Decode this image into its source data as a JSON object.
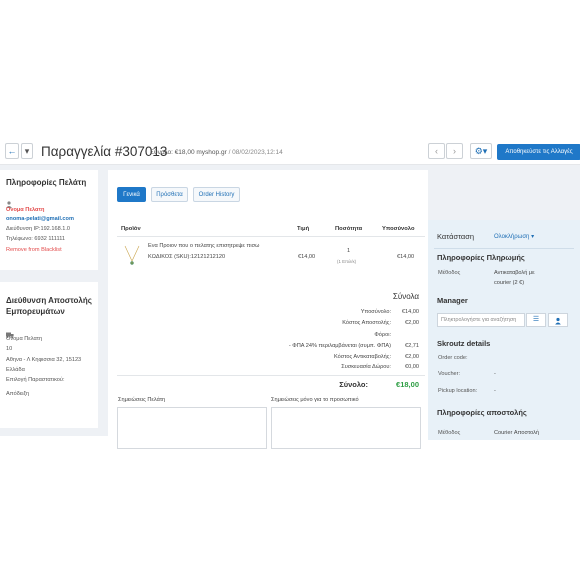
{
  "header": {
    "title": "Παραγγελία #307013",
    "total": "Σύνολο: €18,00",
    "shop": "myshop.gr",
    "date": "/ 08/02/2023,12:14",
    "save_label": "Αποθηκεύστε τις Αλλαγές",
    "back_icon": "←",
    "dropdown_icon": "▾",
    "prev_icon": "‹",
    "next_icon": "›",
    "settings_icon": "⚙▾"
  },
  "customer": {
    "title": "Πληροφορίες Πελάτη",
    "name": "Ονομα Πελατη",
    "email": "onoma-pelati@gmail.com",
    "ip": "Διεύθυνση IP:192.168.1.0",
    "phone": "Τηλέφωνο: 6932 111111",
    "blacklist": "Remove from Blacklist"
  },
  "shipping_address": {
    "title_line1": "Διεύθυνση Αποστολής",
    "title_line2": "Εμπορευμάτων",
    "name": "Ονομα Πελατη",
    "floor": "10",
    "address": "Αθηνα - Λ Κηφισσια 32, 15123",
    "country": "Ελλάδα",
    "doc_label": "Επιλογή Παραστατικού:",
    "doc_value": "Απόδειξη"
  },
  "tabs": [
    "Γενικά",
    "Πρόσθετα",
    "Order History"
  ],
  "products": {
    "headers": {
      "product": "Προϊόν",
      "price": "Τιμή",
      "qty": "Ποσότητα",
      "subtotal": "Υποσύνολο"
    },
    "rows": [
      {
        "name": "Ενα Προιον που ο πελατης επισητρεψε πισω",
        "sku": "ΚΩΔΙΚΟΣ (SKU):12121212120",
        "price": "€14,00",
        "qty": "1",
        "qty_unit": "(1 Επιλ/κ)",
        "subtotal": "€14,00"
      }
    ]
  },
  "totals": {
    "title": "Σύνολα",
    "lines": [
      {
        "label": "Υποσύνολο:",
        "value": "€14,00"
      },
      {
        "label": "Κόστος Αποστολής:",
        "value": "€2,00"
      },
      {
        "label": "Φόροι:",
        "value": ""
      },
      {
        "label": "- ΦΠΑ 24% περιλαμβάνεται (συμπ. ΦΠΑ)",
        "value": "€2,71"
      },
      {
        "label": "Κόστος Αντικαταβολής:",
        "value": "€2,00"
      },
      {
        "label": "Συσκευασία Δώρου:",
        "value": "€0,00"
      }
    ],
    "grand_label": "Σύνολο:",
    "grand_value": "€18,00"
  },
  "notes": {
    "customer_label": "Σημειώσεις Πελάτη",
    "staff_label": "Σημειώσεις μόνο για το προσωπικό"
  },
  "sidebar": {
    "status_label": "Κατάσταση",
    "status_value": "Ολοκλήρωση",
    "payment_title": "Πληροφορίες Πληρωμής",
    "payment_method_label": "Μέθοδος",
    "payment_method_value_1": "Αντικαταβολή με",
    "payment_method_value_2": "courier (2 €)",
    "manager_title": "Manager",
    "manager_placeholder": "Πληκτρολογήστε για αναζήτηση",
    "skroutz_title": "Skroutz details",
    "order_code_label": "Order code:",
    "voucher_label": "Voucher:",
    "voucher_value": "-",
    "pickup_label": "Pickup location:",
    "pickup_value": "-",
    "shipping_title": "Πληροφορίες αποστολής",
    "shipping_method_label": "Μέθοδος",
    "shipping_method_value": "Courier Αποστολή"
  },
  "colors": {
    "primary": "#1f78c8",
    "link": "#1f6fb5",
    "danger": "#e34b4b",
    "success": "#2e9e44",
    "panel": "#e8f1f8"
  }
}
